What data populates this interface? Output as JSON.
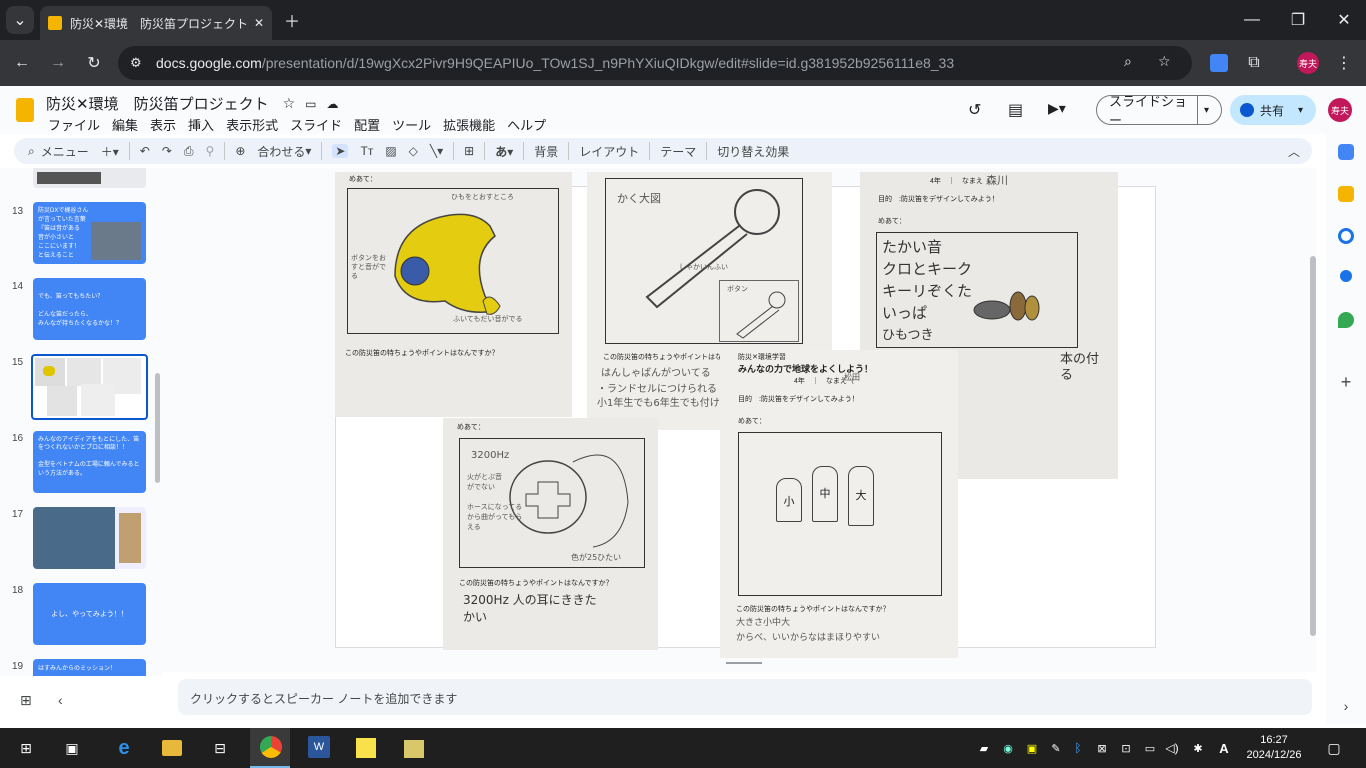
{
  "browser": {
    "tab_title": "防災✕環境　防災笛プロジェクト",
    "url_domain": "docs.google.com",
    "url_path": "/presentation/d/19wgXcx2Pivr9H9QEAPIUo_TOw1SJ_n9PhYXiuQIDkgw/edit#slide=id.g381952b9256111e8_33",
    "profile_label": "寿夫"
  },
  "doc": {
    "title": "防災✕環境　防災笛プロジェクト",
    "menu": [
      "ファイル",
      "編集",
      "表示",
      "挿入",
      "表示形式",
      "スライド",
      "配置",
      "ツール",
      "拡張機能",
      "ヘルプ"
    ],
    "slideshow_label": "スライドショー",
    "share_label": "共有",
    "profile_label": "寿夫"
  },
  "toolbar": {
    "menu_label": "メニュー",
    "zoom_label": "合わせる",
    "background_label": "背景",
    "layout_label": "レイアウト",
    "theme_label": "テーマ",
    "transition_label": "切り替え効果"
  },
  "filmstrip": {
    "slides": [
      {
        "num": "13",
        "text": "防災DXで梶谷さんが言っていた言葉\n『笛は音がある\n音が小さいと\nここにいます！\nと伝えること"
      },
      {
        "num": "14",
        "text": "でも、笛ってもちたい？\n\nどんな笛だったら、\nみんなが持ちたくなるかな！？"
      },
      {
        "num": "15",
        "text": ""
      },
      {
        "num": "16",
        "text": "みんなのアイディアをもとにした、笛をつくれないかとプロに相談！！\n\n金型をベトナムの工場に頼んでみるという方法がある。"
      },
      {
        "num": "17",
        "text": ""
      },
      {
        "num": "18",
        "text": "よし、やってみよう！！"
      },
      {
        "num": "19",
        "text": "はすみんからのミッション！"
      }
    ]
  },
  "worksheets": {
    "aim_label": "めあて：",
    "question": "この防災笛の特ちょうやポイントはなんですか？",
    "purpose": "目的　:防災笛をデザインしてみよう！",
    "grade_name": "4年　｜　なまえ（",
    "header_small": "防災✕環境学習",
    "main_title": "みんなの力で地球をよくしよう！",
    "sheet1_notes": [
      "ひもをとおすところ",
      "ボタンをおすと音がでる",
      "ふいてもだい音がでる"
    ],
    "sheet2_notes": [
      "かく大図",
      "しゃかいんふい",
      "ボタン"
    ],
    "sheet2_answer": [
      "はんしゃばんがついてる",
      "・ランドセルにつけられる",
      "小1年生でも6年生でも付けられる"
    ],
    "sheet3_notes": [
      "たかい音",
      "クロとキーク",
      "キーリぞくた",
      "いっぱ",
      "ひもつき",
      "本の付",
      "る"
    ],
    "sheet3_name": "森川",
    "sheet4_notes": [
      "3200Hz",
      "火がとぶ音がでない",
      "ホースになってるから曲がってもらえる",
      "色が25ひたい"
    ],
    "sheet4_answer": "3200Hz 人の耳にききたかい",
    "sheet5_name": "松田",
    "sheet5_answer": [
      "大きさ小中大",
      "からべ、いいからなはまほりやすい"
    ],
    "sheet5_letters": [
      "大",
      "中",
      "小"
    ]
  },
  "notes": {
    "placeholder": "クリックするとスピーカー ノートを追加できます"
  },
  "taskbar": {
    "time": "16:27",
    "date": "2024/12/26"
  }
}
